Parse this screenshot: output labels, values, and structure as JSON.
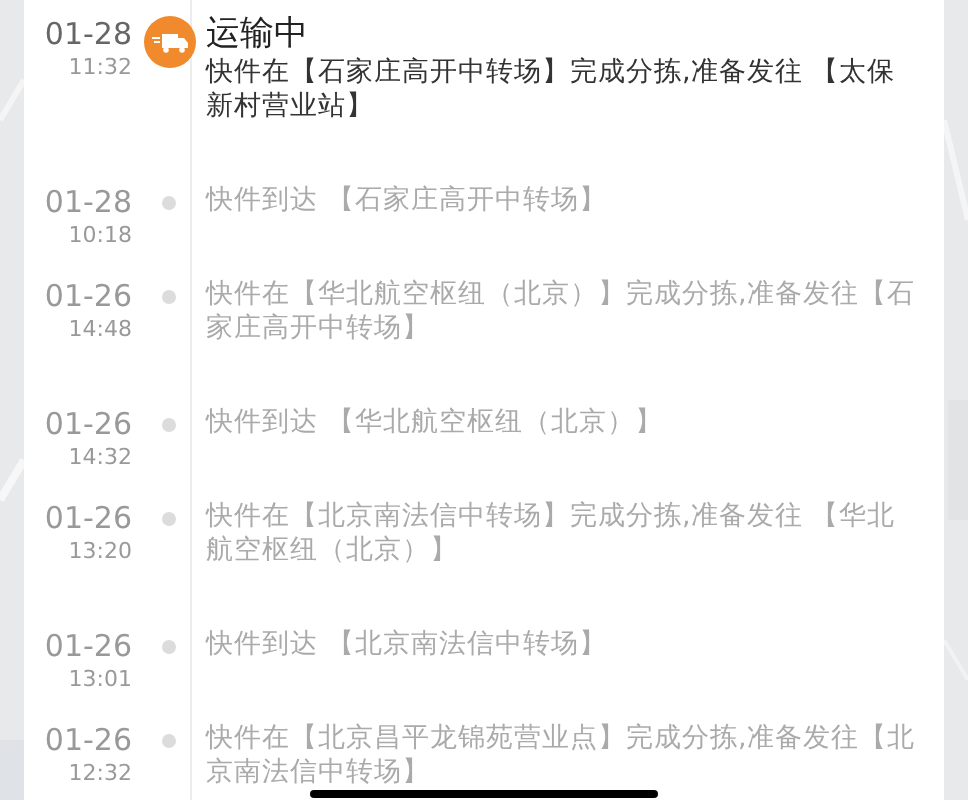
{
  "events": [
    {
      "date": "01-28",
      "time": "11:32",
      "current": true,
      "status": "运输中",
      "text": "快件在【石家庄高开中转场】完成分拣,准备发往 【太保新村营业站】"
    },
    {
      "date": "01-28",
      "time": "10:18",
      "current": false,
      "text": "快件到达 【石家庄高开中转场】"
    },
    {
      "date": "01-26",
      "time": "14:48",
      "current": false,
      "text": "快件在【华北航空枢纽（北京）】完成分拣,准备发往【石家庄高开中转场】"
    },
    {
      "date": "01-26",
      "time": "14:32",
      "current": false,
      "text": "快件到达 【华北航空枢纽（北京）】"
    },
    {
      "date": "01-26",
      "time": "13:20",
      "current": false,
      "text": "快件在【北京南法信中转场】完成分拣,准备发往 【华北航空枢纽（北京）】"
    },
    {
      "date": "01-26",
      "time": "13:01",
      "current": false,
      "text": "快件到达 【北京南法信中转场】"
    },
    {
      "date": "01-26",
      "time": "12:32",
      "current": false,
      "text": "快件在【北京昌平龙锦苑营业点】完成分拣,准备发往【北京南法信中转场】"
    }
  ]
}
